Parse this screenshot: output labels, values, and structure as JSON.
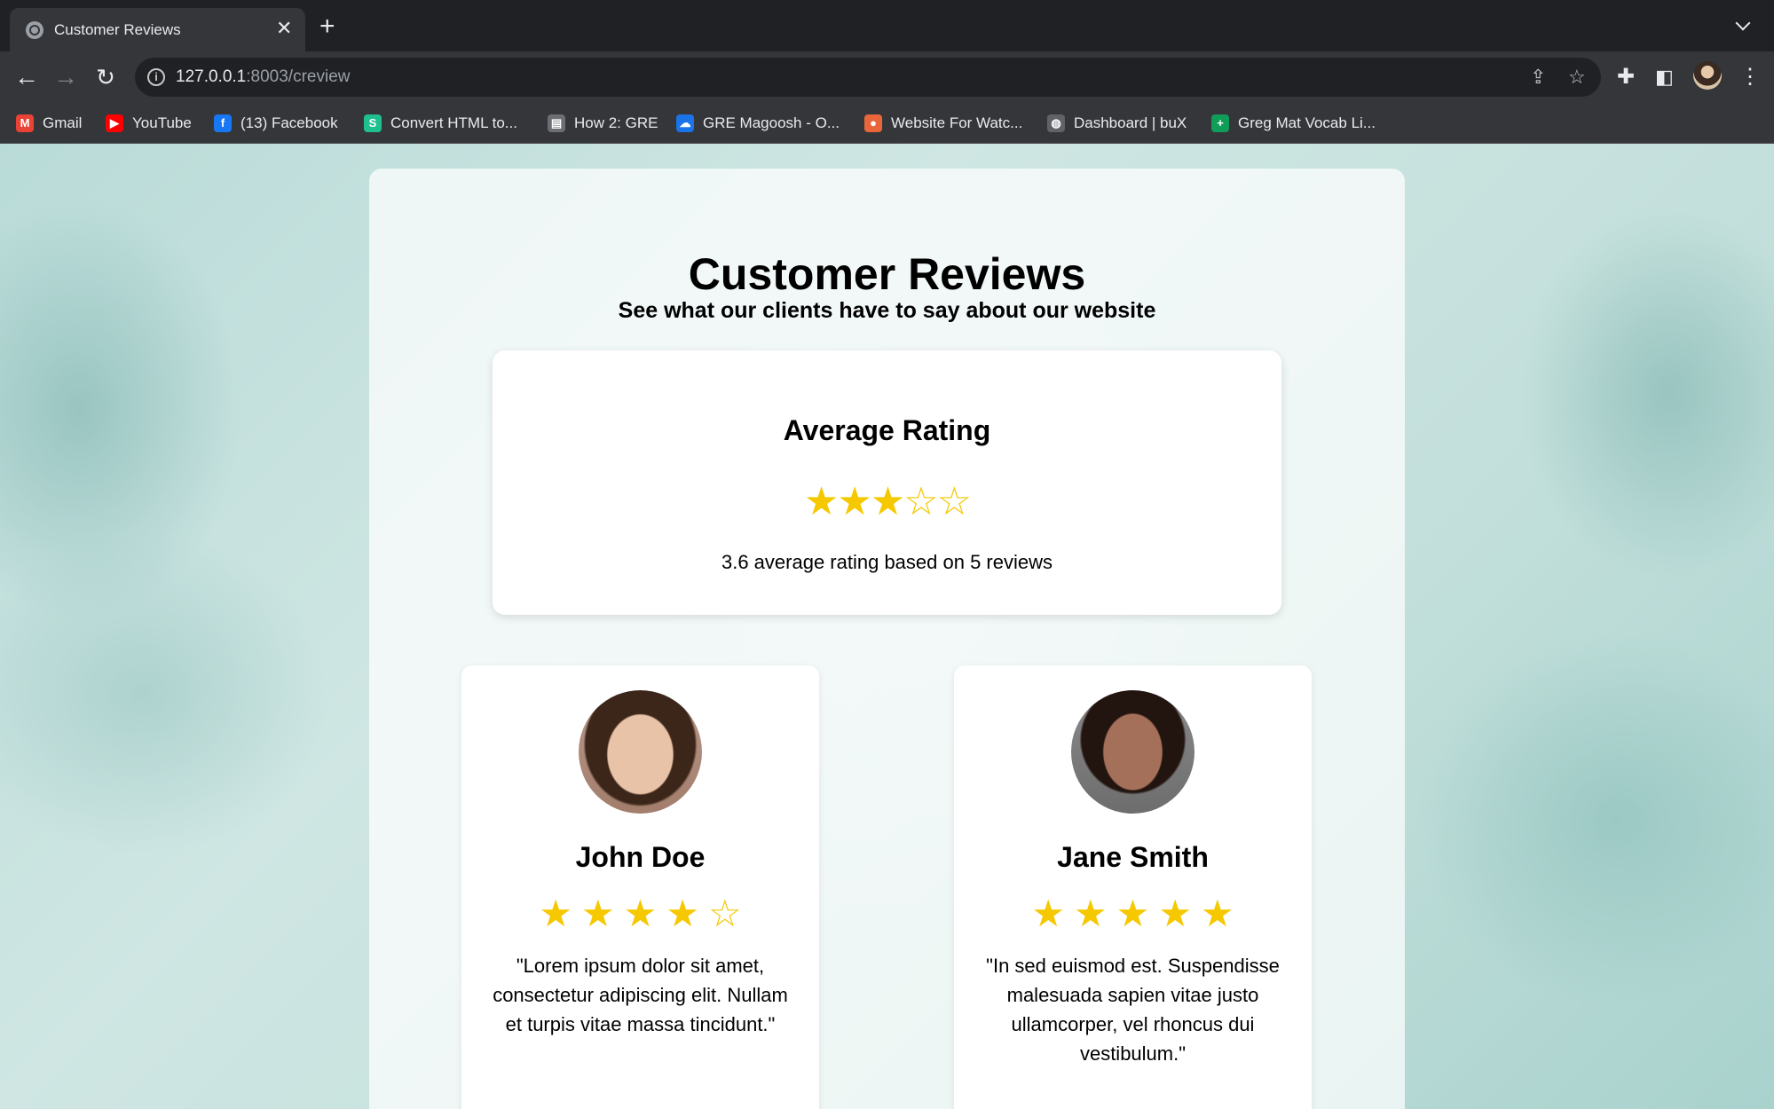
{
  "browser": {
    "tab_title": "Customer Reviews",
    "tab_close": "✕",
    "new_tab": "+",
    "url_host": "127.0.0.1",
    "url_path": ":8003/creview",
    "bookmarks": [
      {
        "label": "Gmail",
        "icon": "gmail-icon",
        "icon_char": "M",
        "color": "#ea4335"
      },
      {
        "label": "YouTube",
        "icon": "youtube-icon",
        "icon_char": "▶",
        "color": "#ff0000"
      },
      {
        "label": "(13) Facebook",
        "icon": "facebook-icon",
        "icon_char": "f",
        "color": "#1877f2"
      },
      {
        "label": "Convert HTML to...",
        "icon": "convert-icon",
        "icon_char": "S",
        "color": "#1fbf8f"
      },
      {
        "label": "How 2: GRE",
        "icon": "document-icon",
        "icon_char": "▤",
        "color": "#6b6f74"
      },
      {
        "label": "GRE Magoosh - O...",
        "icon": "cloud-icon",
        "icon_char": "☁",
        "color": "#1a73e8"
      },
      {
        "label": "Website For Watc...",
        "icon": "website-icon",
        "icon_char": "●",
        "color": "#e8663a"
      },
      {
        "label": "Dashboard | buX",
        "icon": "dashboard-icon",
        "icon_char": "◍",
        "color": "#5f6368"
      },
      {
        "label": "Greg Mat Vocab Li...",
        "icon": "sheets-icon",
        "icon_char": "+",
        "color": "#0f9d58"
      }
    ]
  },
  "page": {
    "title": "Customer Reviews",
    "subtitle": "See what our clients have to say about our website",
    "average": {
      "title": "Average Rating",
      "stars": "★★★☆☆",
      "summary": "3.6 average rating based on 5 reviews"
    },
    "reviews": [
      {
        "name": "John Doe",
        "stars": "★★★★☆",
        "rating": 4,
        "text": "\"Lorem ipsum dolor sit amet, consectetur adipiscing elit. Nullam et turpis vitae massa tincidunt.\""
      },
      {
        "name": "Jane Smith",
        "stars": "★★★★★",
        "rating": 5,
        "text": "\"In sed euismod est. Suspendisse malesuada sapien vitae justo ullamcorper, vel rhoncus dui vestibulum.\""
      }
    ]
  }
}
